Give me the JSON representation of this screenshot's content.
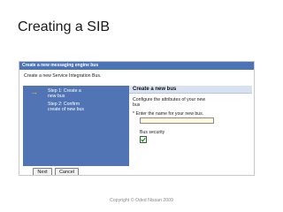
{
  "slide": {
    "title": "Creating a SIB",
    "copyright": "Copyright © Oded Nissan 2009"
  },
  "wizard": {
    "window_title": "Create a new messaging engine bus",
    "description": "Create a new Service Integration Bus.",
    "steps": [
      {
        "lines": [
          "Step 1: Create a",
          "new bus"
        ],
        "current": true
      },
      {
        "lines": [
          "Step 2: Confirm",
          "create of new bus"
        ],
        "current": false
      }
    ],
    "panel": {
      "header": "Create a new bus",
      "instructions": [
        "Configure the attributes of your new",
        "bus"
      ],
      "required_marker": "*",
      "name_prompt": "Enter the name for your new bus.",
      "name_value": "",
      "security_label": "Bus security",
      "security_checked": true
    },
    "buttons": {
      "next": "Next",
      "cancel": "Cancel"
    }
  },
  "colors": {
    "titlebar": "#4b73b6",
    "steps_panel": "#5174b4",
    "panel_header": "#d7e1f0",
    "input_bg": "#fff9dd",
    "current_step_arrow": "#f2c230"
  }
}
